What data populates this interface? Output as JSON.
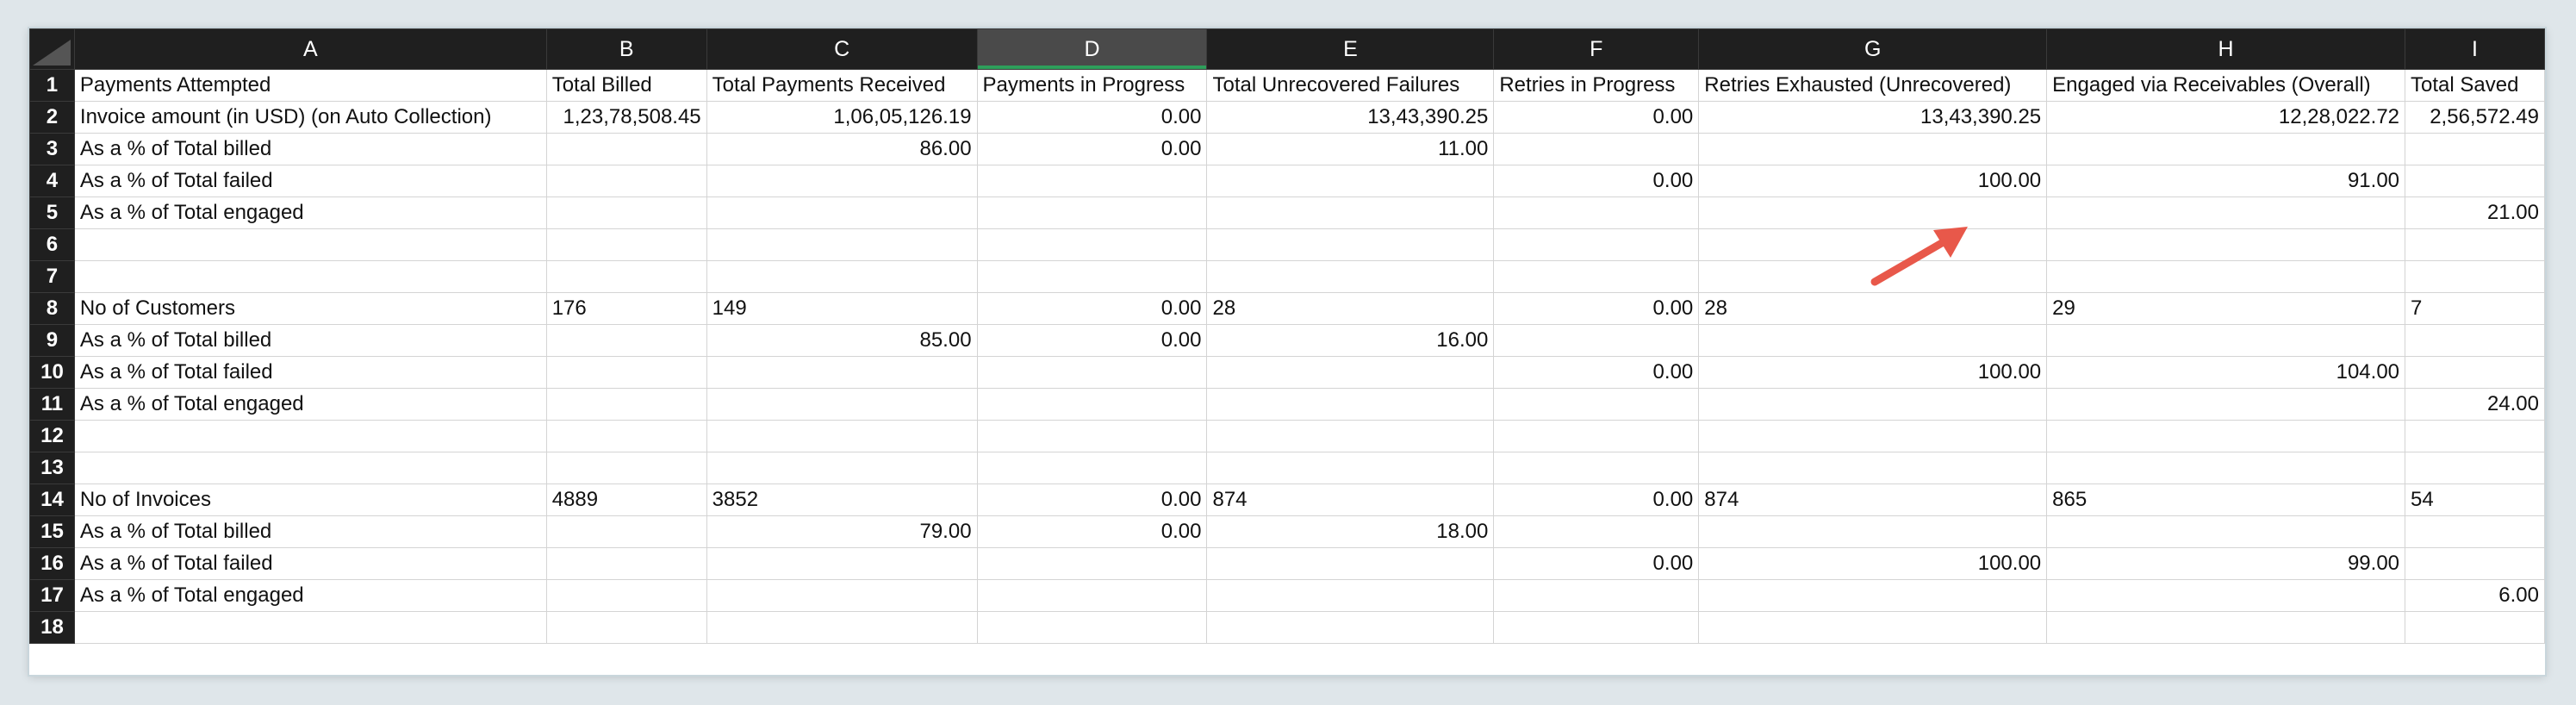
{
  "columns": [
    "A",
    "B",
    "C",
    "D",
    "E",
    "F",
    "G",
    "H",
    "I"
  ],
  "selected_column": "D",
  "rows": [
    {
      "n": "1",
      "cells": [
        "Payments Attempted",
        "Total Billed",
        "Total Payments Received",
        "Payments in Progress",
        "Total Unrecovered Failures",
        "Retries in Progress",
        "Retries Exhausted (Unrecovered)",
        "Engaged via Receivables (Overall)",
        "Total Saved"
      ]
    },
    {
      "n": "2",
      "cells": [
        "Invoice amount (in USD) (on Auto Collection)",
        "1,23,78,508.45",
        "1,06,05,126.19",
        "0.00",
        "13,43,390.25",
        "0.00",
        "13,43,390.25",
        "12,28,022.72",
        "2,56,572.49"
      ]
    },
    {
      "n": "3",
      "cells": [
        "As a % of Total billed",
        "",
        "86.00",
        "0.00",
        "11.00",
        "",
        "",
        "",
        ""
      ]
    },
    {
      "n": "4",
      "cells": [
        "As a % of Total failed",
        "",
        "",
        "",
        "",
        "0.00",
        "100.00",
        "91.00",
        ""
      ]
    },
    {
      "n": "5",
      "cells": [
        "As a % of Total engaged",
        "",
        "",
        "",
        "",
        "",
        "",
        "",
        "21.00"
      ]
    },
    {
      "n": "6",
      "cells": [
        "",
        "",
        "",
        "",
        "",
        "",
        "",
        "",
        ""
      ]
    },
    {
      "n": "7",
      "cells": [
        "",
        "",
        "",
        "",
        "",
        "",
        "",
        "",
        ""
      ]
    },
    {
      "n": "8",
      "cells": [
        "No of Customers",
        "176",
        "149",
        "0.00",
        "28",
        "0.00",
        "28",
        "29",
        "7"
      ]
    },
    {
      "n": "9",
      "cells": [
        "As a % of Total billed",
        "",
        "85.00",
        "0.00",
        "16.00",
        "",
        "",
        "",
        ""
      ]
    },
    {
      "n": "10",
      "cells": [
        "As a % of Total failed",
        "",
        "",
        "",
        "",
        "0.00",
        "100.00",
        "104.00",
        ""
      ]
    },
    {
      "n": "11",
      "cells": [
        "As a % of Total engaged",
        "",
        "",
        "",
        "",
        "",
        "",
        "",
        "24.00"
      ]
    },
    {
      "n": "12",
      "cells": [
        "",
        "",
        "",
        "",
        "",
        "",
        "",
        "",
        ""
      ]
    },
    {
      "n": "13",
      "cells": [
        "",
        "",
        "",
        "",
        "",
        "",
        "",
        "",
        ""
      ]
    },
    {
      "n": "14",
      "cells": [
        "No of Invoices",
        "4889",
        "3852",
        "0.00",
        "874",
        "0.00",
        "874",
        "865",
        "54"
      ]
    },
    {
      "n": "15",
      "cells": [
        "As a % of Total billed",
        "",
        "79.00",
        "0.00",
        "18.00",
        "",
        "",
        "",
        ""
      ]
    },
    {
      "n": "16",
      "cells": [
        "As a % of Total failed",
        "",
        "",
        "",
        "",
        "0.00",
        "100.00",
        "99.00",
        ""
      ]
    },
    {
      "n": "17",
      "cells": [
        "As a % of Total engaged",
        "",
        "",
        "",
        "",
        "",
        "",
        "",
        "6.00"
      ]
    },
    {
      "n": "18",
      "cells": [
        "",
        "",
        "",
        "",
        "",
        "",
        "",
        "",
        ""
      ]
    }
  ],
  "right_aligned": {
    "2": [
      1,
      2,
      3,
      4,
      5,
      6,
      7,
      8
    ],
    "3": [
      2,
      3,
      4
    ],
    "4": [
      5,
      6,
      7
    ],
    "5": [
      8
    ],
    "8": [
      3,
      5
    ],
    "9": [
      2,
      3,
      4
    ],
    "10": [
      5,
      6,
      7
    ],
    "11": [
      8
    ],
    "14": [
      3,
      5
    ],
    "15": [
      2,
      3,
      4
    ],
    "16": [
      5,
      6,
      7
    ],
    "17": [
      8
    ]
  },
  "annotation": {
    "arrow_color": "#e8584a"
  }
}
